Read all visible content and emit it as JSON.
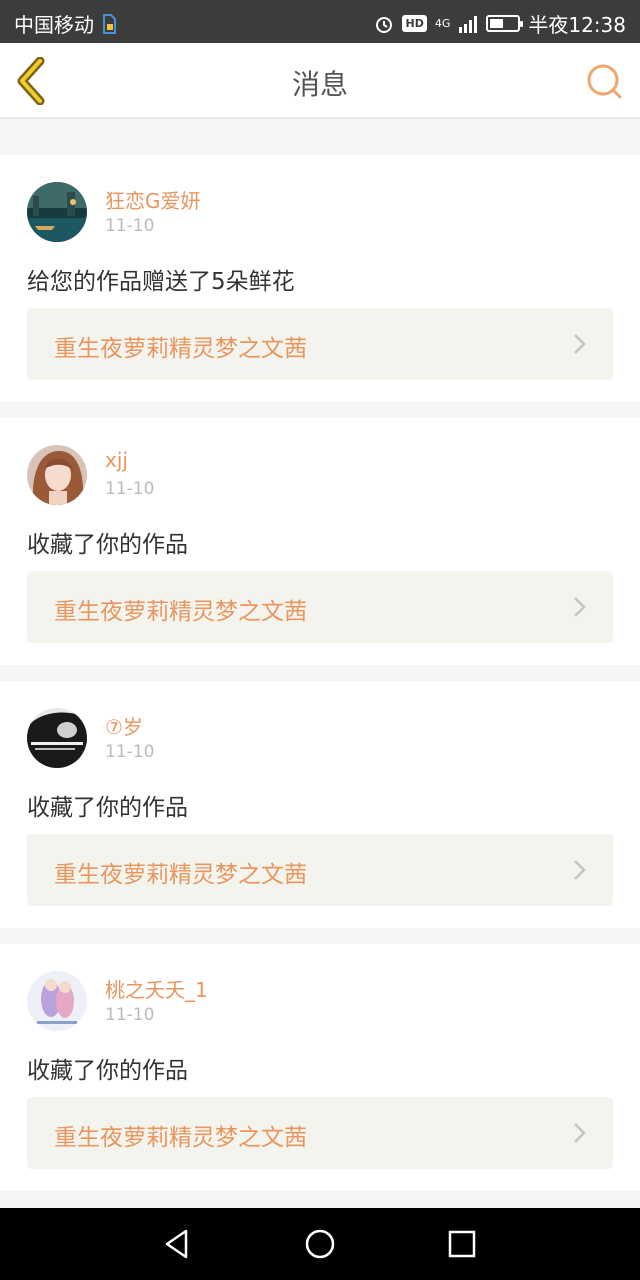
{
  "status_bar": {
    "carrier": "中国移动",
    "network": "4G",
    "hd": "HD",
    "time": "半夜12:38",
    "battery_level": 0.5
  },
  "header": {
    "title": "消息"
  },
  "messages": [
    {
      "username": "狂恋G爱妍",
      "date": "11-10",
      "action": "给您的作品赠送了5朵鲜花",
      "work_title": "重生夜萝莉精灵梦之文茜"
    },
    {
      "username": "xjj",
      "date": "11-10",
      "action": "收藏了你的作品",
      "work_title": "重生夜萝莉精灵梦之文茜"
    },
    {
      "username": "⑦岁",
      "date": "11-10",
      "action": "收藏了你的作品",
      "work_title": "重生夜萝莉精灵梦之文茜"
    },
    {
      "username": "桃之夭夭_1",
      "date": "11-10",
      "action": "收藏了你的作品",
      "work_title": "重生夜萝莉精灵梦之文茜"
    }
  ],
  "colors": {
    "accent": "#e8965e",
    "status_bar": "#3c3c3c",
    "card_bg": "#ffffff",
    "work_bg": "#f4f4ef",
    "page_bg": "#f6f6f6"
  },
  "icons": {
    "back": "back-chevron-icon",
    "search": "search-icon",
    "nav_back": "triangle-back-icon",
    "nav_home": "circle-home-icon",
    "nav_recents": "square-recents-icon"
  }
}
